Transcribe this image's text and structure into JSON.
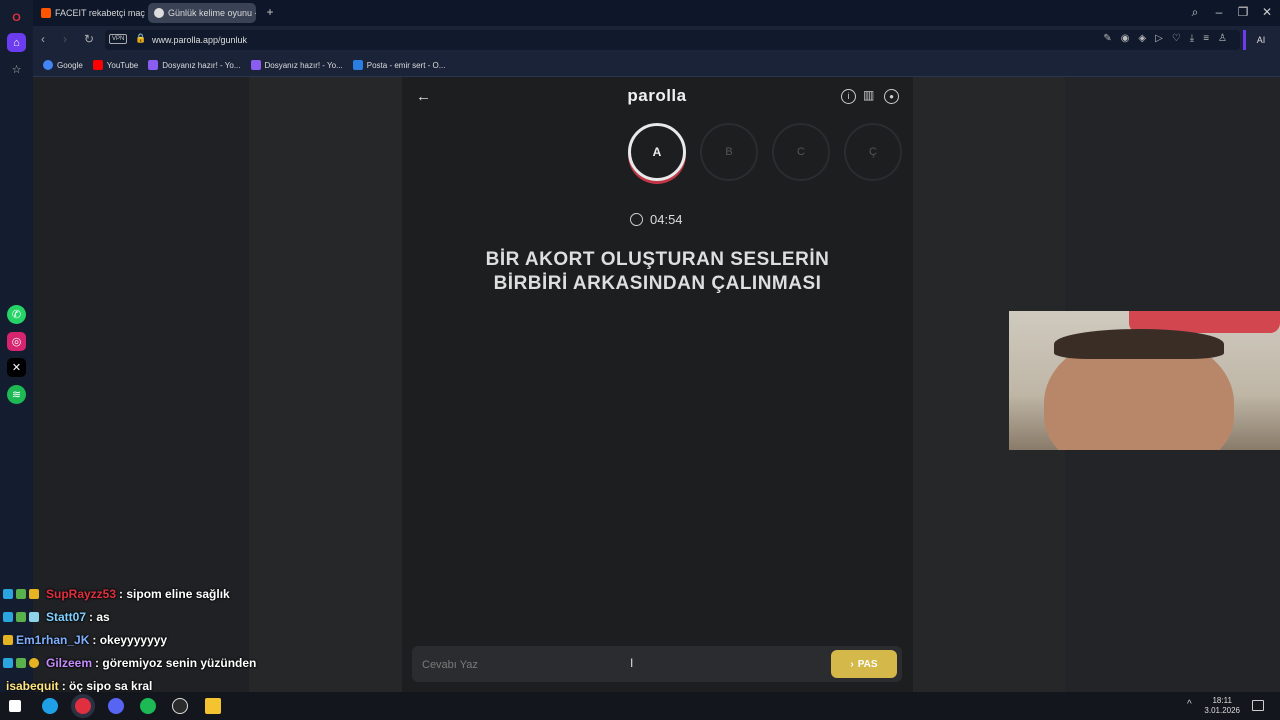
{
  "browser": {
    "tabs": [
      {
        "label": "FACEIT rekabetçi maç - FA",
        "active": false
      },
      {
        "label": "Günlük kelime oyunu - pa",
        "active": true
      }
    ],
    "url": "www.parolla.app/gunluk",
    "vpn_label": "VPN",
    "ai_label": "AI",
    "bookmarks": [
      {
        "label": "Google"
      },
      {
        "label": "YouTube"
      },
      {
        "label": "Dosyanız hazır! - Yo..."
      },
      {
        "label": "Dosyanız hazır! - Yo..."
      },
      {
        "label": "Posta - emir sert - O..."
      }
    ]
  },
  "app": {
    "title": "parolla",
    "letters": [
      {
        "letter": "A",
        "active": true
      },
      {
        "letter": "B",
        "active": false
      },
      {
        "letter": "C",
        "active": false
      },
      {
        "letter": "Ç",
        "active": false
      }
    ],
    "timer": "04:54",
    "question_line1": "BİR AKORT OLUŞTURAN SESLERİN",
    "question_line2": "BİRBİRİ ARKASINDAN ÇALINMASI",
    "answer_placeholder": "Cevabı Yaz",
    "pass_label": "PAS"
  },
  "chat": [
    {
      "user": "SupRayzz53",
      "message": ": sipom eline sağlık",
      "color": "#e0303f"
    },
    {
      "user": "Statt07",
      "message": ": as",
      "color": "#7fd0ff"
    },
    {
      "user": "Em1rhan_JK",
      "message": ": okeyyyyyyy",
      "color": "#7fb0ff"
    },
    {
      "user": "Gilzeem",
      "message": ": göremiyoz senin yüzünden",
      "color": "#c48cff"
    },
    {
      "user": "isabequit",
      "message": ": öç sipo sa kral",
      "color": "#ffe680"
    }
  ],
  "taskbar": {
    "time": "18:11",
    "date": "3.01.2026"
  }
}
